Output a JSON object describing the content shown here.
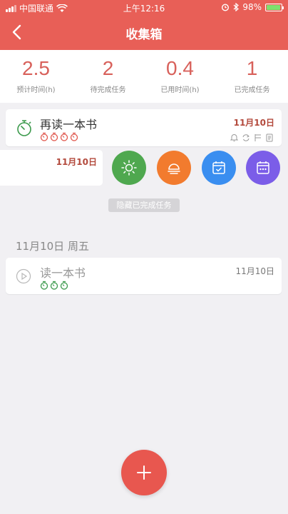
{
  "status_bar": {
    "carrier": "中国联通",
    "time": "上午12:16",
    "battery": "98%"
  },
  "header": {
    "title": "收集箱"
  },
  "stats": [
    {
      "value": "2.5",
      "label": "预计时间(h)"
    },
    {
      "value": "2",
      "label": "待完成任务"
    },
    {
      "value": "0.4",
      "label": "已用时间(h)"
    },
    {
      "value": "1",
      "label": "已完成任务"
    }
  ],
  "tasks": [
    {
      "title": "再读一本书",
      "date": "11月10日",
      "pomodoros": 4
    },
    {
      "title": "读一本书",
      "date": "11月10日",
      "pomodoros": 3
    }
  ],
  "swiped_row": {
    "date": "11月10日"
  },
  "quick_actions": [
    {
      "name": "today",
      "icon": "sun-icon",
      "color": "#4fa84f"
    },
    {
      "name": "tomorrow",
      "icon": "sunset-icon",
      "color": "#f27b2e"
    },
    {
      "name": "schedule",
      "icon": "calendar-check-icon",
      "color": "#3a8ef0"
    },
    {
      "name": "someday",
      "icon": "calendar-dots-icon",
      "color": "#7b5de8"
    }
  ],
  "hide_completed_label": "隐藏已完成任务",
  "section": {
    "date_label": "11月10日 周五"
  },
  "colors": {
    "accent": "#e85f57",
    "pomodoro_green": "#3c9a4c",
    "date_red": "#b34a3d"
  }
}
